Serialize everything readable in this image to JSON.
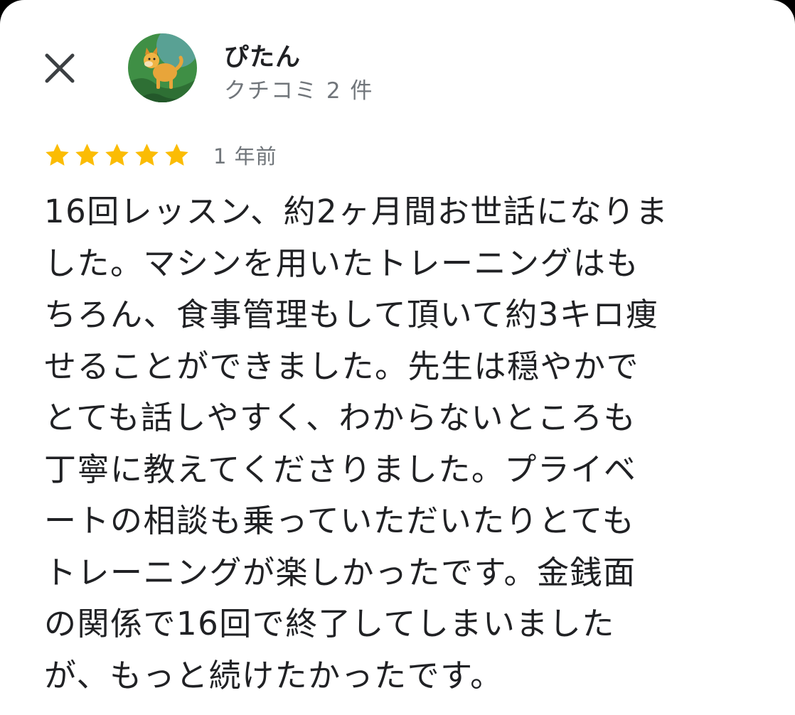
{
  "reviewer": {
    "name": "ぴたん",
    "review_count": "クチコミ 2 件",
    "avatar_icon": "shiba-dog-avatar-icon"
  },
  "header": {
    "close_icon": "close-icon"
  },
  "review": {
    "rating": 5,
    "max_rating": 5,
    "star_color": "#fbbc04",
    "time_ago": "1 年前",
    "lines": [
      "16回レッスン、約2ヶ月間お世話になりま",
      "した。マシンを用いたトレーニングはも",
      "ちろん、食事管理もして頂いて約3キロ痩",
      "せることができました。先生は穏やかで",
      "とても話しやすく、わからないところも",
      "丁寧に教えてくださりました。プライベ",
      "ートの相談も乗っていただいたりとても",
      "トレーニングが楽しかったです。金銭面",
      "の関係で16回で終了してしまいました",
      "が、もっと続けたかったです。"
    ]
  }
}
